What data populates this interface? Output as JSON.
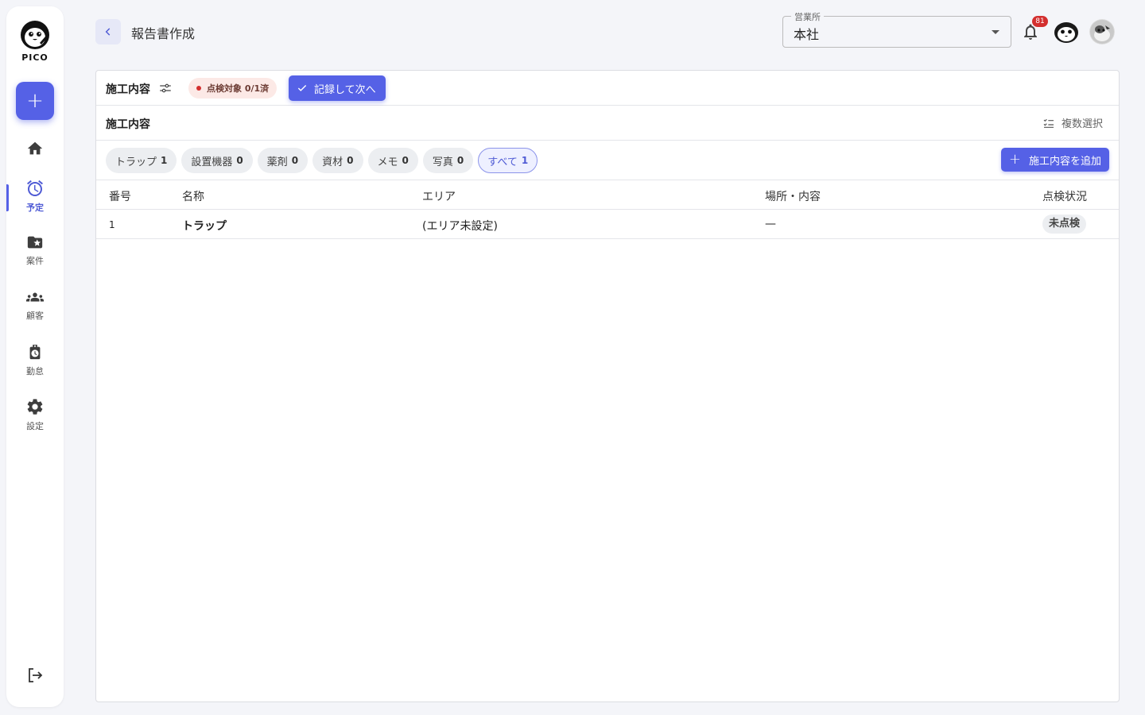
{
  "sidebar": {
    "logo_text": "PICO",
    "add_label": "+",
    "items": [
      {
        "label": ""
      },
      {
        "label": "予定"
      },
      {
        "label": "案件"
      },
      {
        "label": "顧客"
      },
      {
        "label": "勤怠"
      },
      {
        "label": "設定"
      }
    ]
  },
  "header": {
    "title": "報告書作成",
    "office_label": "営業所",
    "office_value": "本社",
    "notification_count": "81"
  },
  "panel": {
    "section_title": "施工内容",
    "inspect_status": "点検対象 0/1済",
    "record_button": "記録して次へ",
    "list_title": "施工内容",
    "multi_select": "複数選択",
    "add_button": "施工内容を追加",
    "filters": [
      {
        "label": "トラップ",
        "count": "1"
      },
      {
        "label": "設置機器",
        "count": "0"
      },
      {
        "label": "薬剤",
        "count": "0"
      },
      {
        "label": "資材",
        "count": "0"
      },
      {
        "label": "メモ",
        "count": "0"
      },
      {
        "label": "写真",
        "count": "0"
      },
      {
        "label": "すべて",
        "count": "1",
        "selected": true
      }
    ],
    "columns": [
      "番号",
      "名称",
      "エリア",
      "場所・内容",
      "点検状況"
    ],
    "rows": [
      {
        "no": "1",
        "name": "トラップ",
        "area": "(エリア未設定)",
        "place": "—",
        "status": "未点検"
      }
    ]
  },
  "colors": {
    "accent": "#5561e6",
    "badge": "#d32f2f",
    "background": "#f4f5f9"
  }
}
